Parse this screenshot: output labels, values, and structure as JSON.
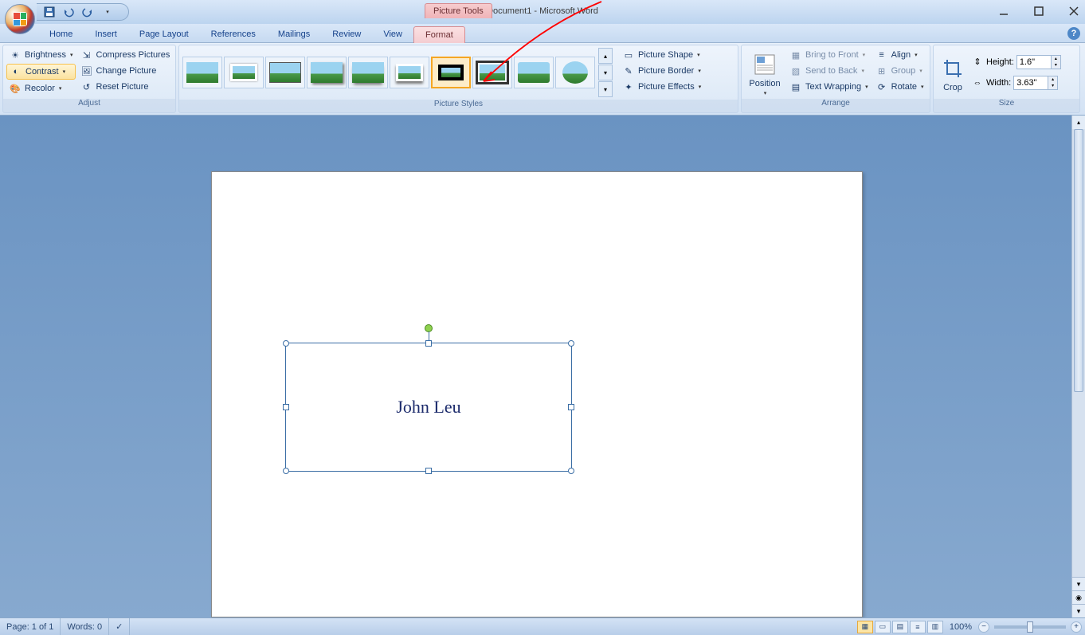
{
  "app": {
    "title": "Document1 - Microsoft Word",
    "contextual_tab_title": "Picture Tools"
  },
  "tabs": {
    "home": "Home",
    "insert": "Insert",
    "page_layout": "Page Layout",
    "references": "References",
    "mailings": "Mailings",
    "review": "Review",
    "view": "View",
    "format": "Format"
  },
  "ribbon": {
    "adjust": {
      "label": "Adjust",
      "brightness": "Brightness",
      "contrast": "Contrast",
      "recolor": "Recolor",
      "compress": "Compress Pictures",
      "change": "Change Picture",
      "reset": "Reset Picture"
    },
    "styles": {
      "label": "Picture Styles",
      "shape": "Picture Shape",
      "border": "Picture Border",
      "effects": "Picture Effects"
    },
    "arrange": {
      "label": "Arrange",
      "position": "Position",
      "bring_front": "Bring to Front",
      "send_back": "Send to Back",
      "wrap": "Text Wrapping",
      "align": "Align",
      "group": "Group",
      "rotate": "Rotate"
    },
    "size": {
      "label": "Size",
      "crop": "Crop",
      "height_lbl": "Height:",
      "width_lbl": "Width:",
      "height_val": "1.6\"",
      "width_val": "3.63\""
    }
  },
  "document": {
    "signature_text": "John Leu"
  },
  "statusbar": {
    "page": "Page: 1 of 1",
    "words": "Words: 0",
    "zoom": "100%"
  }
}
